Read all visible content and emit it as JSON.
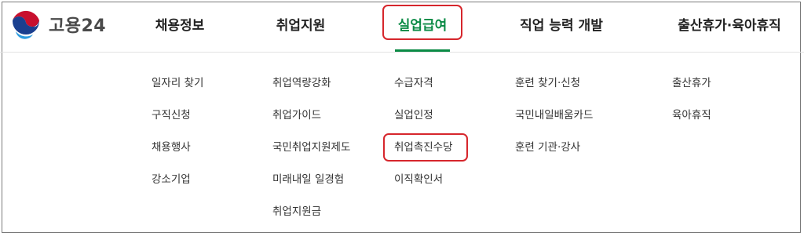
{
  "logo": {
    "text": "고용24"
  },
  "nav": [
    {
      "label": "채용정보"
    },
    {
      "label": "취업지원"
    },
    {
      "label": "실업급여"
    },
    {
      "label": "직업 능력 개발"
    },
    {
      "label": "출산휴가·육아휴직"
    }
  ],
  "submenu": {
    "col0": [
      "일자리 찾기",
      "구직신청",
      "채용행사",
      "강소기업"
    ],
    "col1": [
      "취업역량강화",
      "취업가이드",
      "국민취업지원제도",
      "미래내일 일경험",
      "취업지원금"
    ],
    "col2": [
      "수급자격",
      "실업인정",
      "취업촉진수당",
      "이직확인서"
    ],
    "col3": [
      "훈련 찾기·신청",
      "국민내일배움카드",
      "훈련 기관·강사"
    ],
    "col4": [
      "출산휴가",
      "육아휴직"
    ]
  },
  "colors": {
    "accent_green": "#0a8a45",
    "highlight_red": "#d6262c"
  }
}
